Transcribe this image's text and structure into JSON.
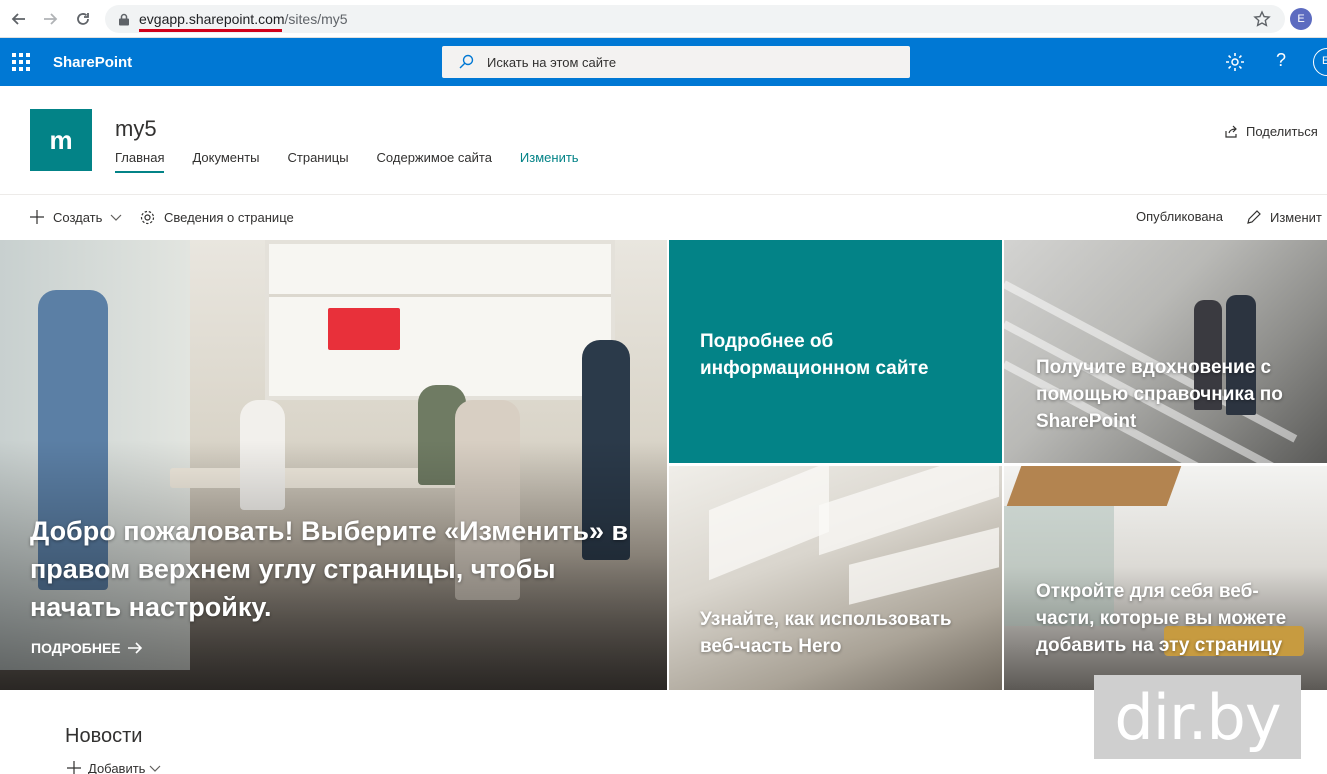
{
  "browser": {
    "url_domain": "evgapp.sharepoint.com",
    "url_path": "/sites/my5",
    "profile_initial": "E"
  },
  "suite": {
    "app_name": "SharePoint",
    "search_placeholder": "Искать на этом сайте",
    "help_label": "?",
    "user_initial": "E"
  },
  "site": {
    "logo_letter": "m",
    "title": "my5",
    "nav": [
      {
        "label": "Главная",
        "active": true
      },
      {
        "label": "Документы"
      },
      {
        "label": "Страницы"
      },
      {
        "label": "Содержимое сайта"
      },
      {
        "label": "Изменить"
      }
    ],
    "share_label": "Поделиться"
  },
  "command_bar": {
    "new_label": "Создать",
    "page_details_label": "Сведения о странице",
    "status_label": "Опубликована",
    "edit_label": "Изменит"
  },
  "hero": {
    "main_caption": "Добро пожаловать! Выберите «Изменить» в правом верхнем углу страницы, чтобы начать настройку.",
    "main_link": "ПОДРОБНЕЕ",
    "tiles": [
      {
        "caption": "Подробнее об информационном сайте"
      },
      {
        "caption": "Получите вдохновение с помощью справочника по SharePoint"
      },
      {
        "caption": "Узнайте, как использовать веб-часть Hero"
      },
      {
        "caption": "Откройте для себя веб-части, которые вы можете добавить на эту страницу"
      }
    ]
  },
  "news": {
    "title": "Новости",
    "add_label": "Добавить"
  },
  "watermark": "dir.by",
  "colors": {
    "suite_bar": "#0078d4",
    "site_accent": "#038387",
    "url_underline": "#d0021b"
  }
}
